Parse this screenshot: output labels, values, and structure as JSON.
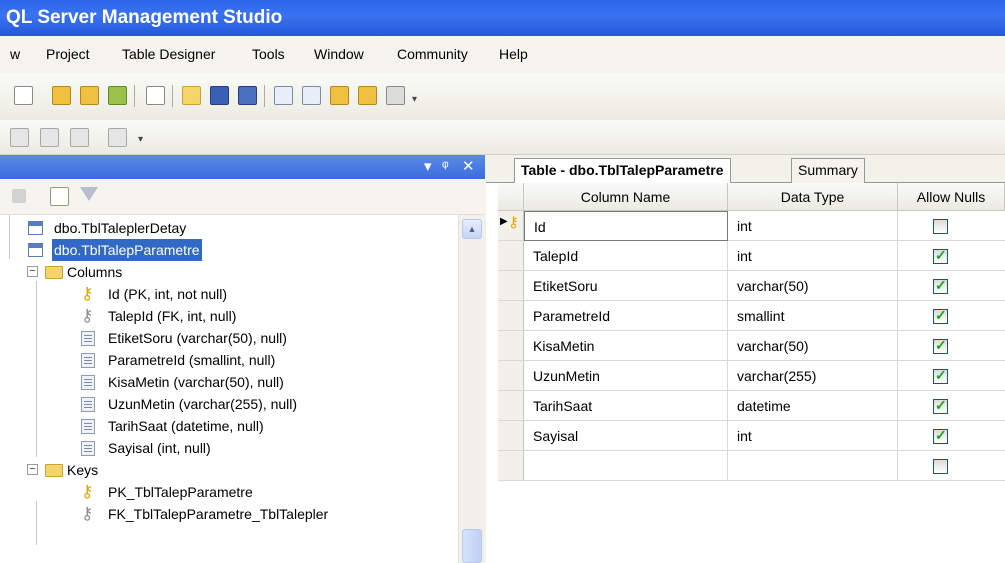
{
  "window": {
    "title": "QL Server Management Studio"
  },
  "menu": [
    "w",
    "Project",
    "Table Designer",
    "Tools",
    "Window",
    "Community",
    "Help"
  ],
  "object_explorer": {
    "header_buttons": [
      "▾",
      "ᵠ",
      "✕"
    ],
    "tree": [
      {
        "label": "dbo.TblTaleplerDetay",
        "icon": "table-icon"
      },
      {
        "label": "dbo.TblTalepParametre",
        "icon": "table-icon",
        "selected": true
      },
      {
        "label": "Columns",
        "icon": "folder-icon",
        "expander": "−"
      },
      {
        "label": "Id (PK, int, not null)",
        "icon": "primary-key-icon"
      },
      {
        "label": "TalepId (FK, int, null)",
        "icon": "foreign-key-icon"
      },
      {
        "label": "EtiketSoru (varchar(50), null)",
        "icon": "column-icon"
      },
      {
        "label": "ParametreId (smallint, null)",
        "icon": "column-icon"
      },
      {
        "label": "KisaMetin (varchar(50), null)",
        "icon": "column-icon"
      },
      {
        "label": "UzunMetin (varchar(255), null)",
        "icon": "column-icon"
      },
      {
        "label": "TarihSaat (datetime, null)",
        "icon": "column-icon"
      },
      {
        "label": "Sayisal (int, null)",
        "icon": "column-icon"
      },
      {
        "label": "Keys",
        "icon": "folder-icon",
        "expander": "−"
      },
      {
        "label": "PK_TblTalepParametre",
        "icon": "primary-key-icon"
      },
      {
        "label": "FK_TblTalepParametre_TblTalepler",
        "icon": "foreign-key-icon"
      }
    ]
  },
  "designer": {
    "tabs": [
      {
        "label": "Table - dbo.TblTalepParametre",
        "active": true
      },
      {
        "label": "Summary",
        "active": false
      }
    ],
    "columns_header": [
      "Column Name",
      "Data Type",
      "Allow Nulls"
    ],
    "rows": [
      {
        "name": "Id",
        "type": "int",
        "allow_nulls": false,
        "primary_key": true
      },
      {
        "name": "TalepId",
        "type": "int",
        "allow_nulls": true
      },
      {
        "name": "EtiketSoru",
        "type": "varchar(50)",
        "allow_nulls": true
      },
      {
        "name": "ParametreId",
        "type": "smallint",
        "allow_nulls": true
      },
      {
        "name": "KisaMetin",
        "type": "varchar(50)",
        "allow_nulls": true
      },
      {
        "name": "UzunMetin",
        "type": "varchar(255)",
        "allow_nulls": true
      },
      {
        "name": "TarihSaat",
        "type": "datetime",
        "allow_nulls": true
      },
      {
        "name": "Sayisal",
        "type": "int",
        "allow_nulls": true
      },
      {
        "name": "",
        "type": "",
        "allow_nulls": false
      }
    ]
  },
  "colors": {
    "title_bar": "#2a63e6",
    "selection": "#316ac5",
    "check": "#21a121"
  }
}
